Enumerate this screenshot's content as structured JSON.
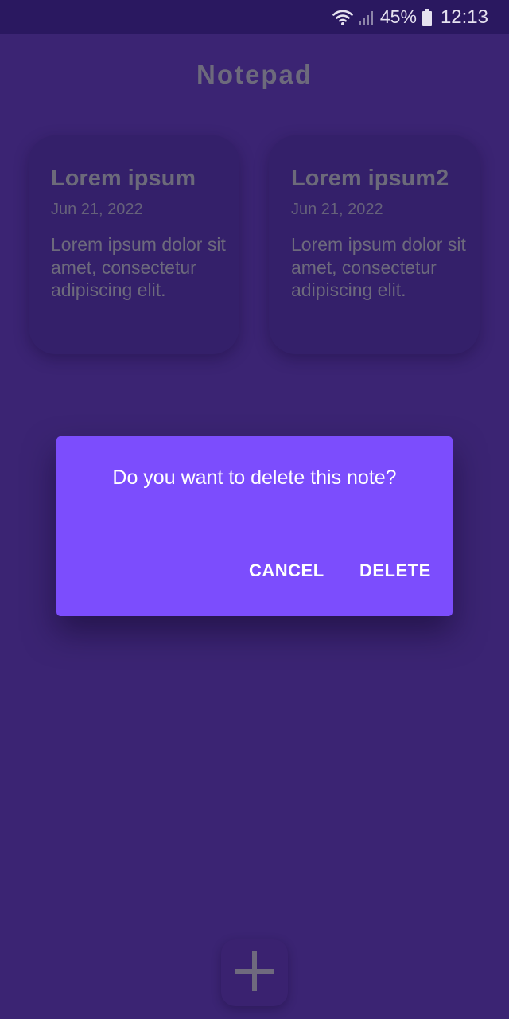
{
  "status_bar": {
    "battery": "45%",
    "time": "12:13",
    "icons": [
      "wifi-icon",
      "signal-icon",
      "battery-icon"
    ]
  },
  "header": {
    "title": "Notepad"
  },
  "notes": [
    {
      "title": "Lorem ipsum",
      "date": "Jun 21, 2022",
      "body": "Lorem ipsum dolor sit amet, consectetur adipiscing elit."
    },
    {
      "title": "Lorem ipsum2",
      "date": "Jun 21, 2022",
      "body": "Lorem ipsum dolor sit amet, consectetur adipiscing elit."
    }
  ],
  "dialog": {
    "message": "Do you want to delete this note?",
    "cancel_label": "CANCEL",
    "delete_label": "DELETE"
  },
  "fab": {
    "icon": "plus-icon"
  },
  "colors": {
    "background": "#3b2473",
    "status_bar": "#2a1860",
    "dialog": "#7c4dfd",
    "card": "#34206a"
  }
}
